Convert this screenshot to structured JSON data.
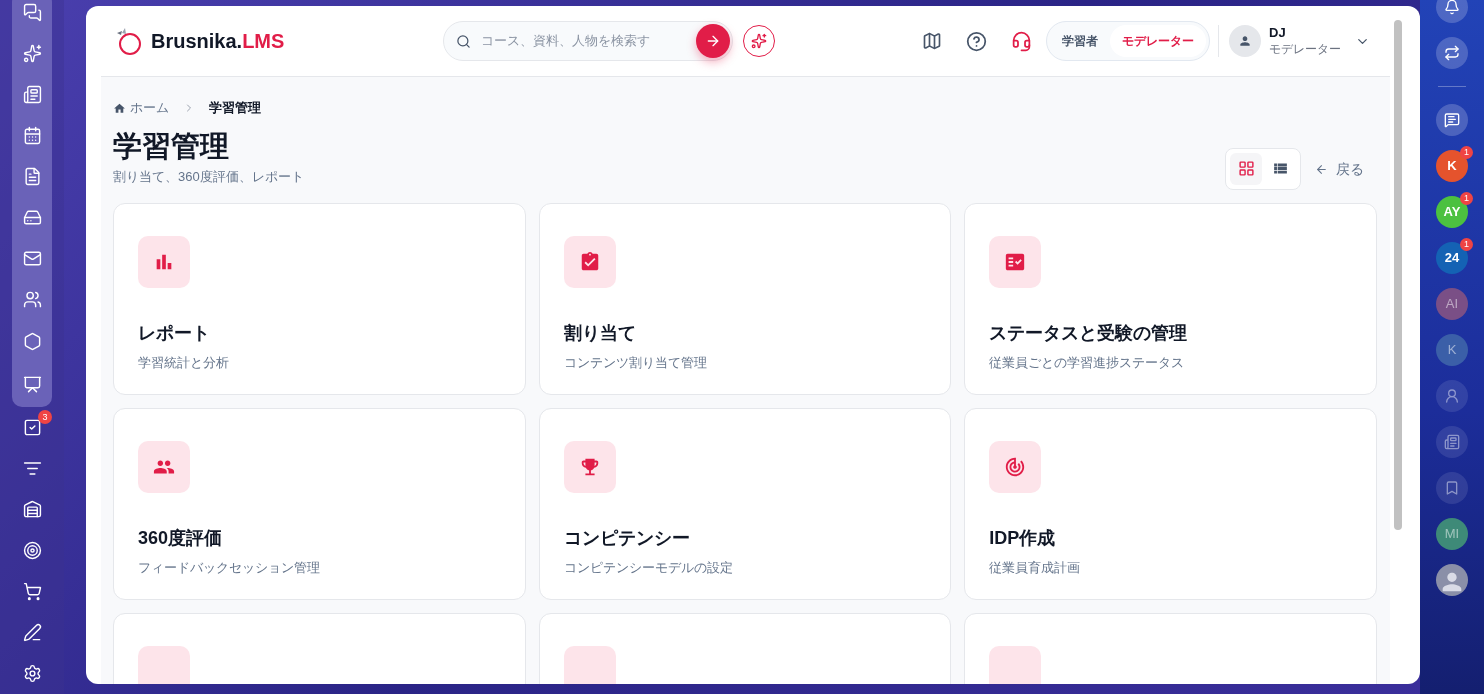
{
  "left_rail": {
    "items": [
      {
        "grouped": true
      },
      {
        "grouped": true
      },
      {
        "grouped": true
      },
      {
        "grouped": true
      },
      {
        "grouped": true
      },
      {
        "grouped": true
      },
      {
        "grouped": true
      },
      {
        "grouped": true
      },
      {
        "grouped": true
      },
      {
        "grouped": true
      },
      {
        "grouped": false,
        "badge": "3"
      },
      {
        "grouped": false
      },
      {
        "grouped": false
      },
      {
        "grouped": false
      },
      {
        "grouped": false
      },
      {
        "grouped": false
      },
      {
        "grouped": false
      }
    ]
  },
  "header": {
    "logo": {
      "brand": "Brusnika.",
      "suffix": "LMS"
    },
    "search": {
      "placeholder": "コース、資料、人物を検索す"
    },
    "roles": [
      {
        "label": "学習者",
        "selected": false
      },
      {
        "label": "モデレーター",
        "selected": true
      }
    ],
    "user": {
      "initials": "DJ",
      "role": "モデレーター"
    }
  },
  "breadcrumb": [
    {
      "label": "ホーム",
      "kind": "home"
    },
    {
      "label": "学習管理",
      "kind": "current"
    }
  ],
  "page": {
    "title": "学習管理",
    "subtitle": "割り当て、360度評価、レポート",
    "back": "戻る",
    "views": [
      {
        "kind": "grid",
        "selected": true
      },
      {
        "kind": "list",
        "selected": false
      }
    ]
  },
  "cards": [
    {
      "kind": "full",
      "title": "レポート",
      "subtitle": "学習統計と分析"
    },
    {
      "kind": "full",
      "title": "割り当て",
      "subtitle": "コンテンツ割り当て管理"
    },
    {
      "kind": "full",
      "title": "ステータスと受験の管理",
      "subtitle": "従業員ごとの学習進捗ステータス"
    },
    {
      "kind": "full",
      "title": "360度評価",
      "subtitle": "フィードバックセッション管理"
    },
    {
      "kind": "full",
      "title": "コンピテンシー",
      "subtitle": "コンピテンシーモデルの設定"
    },
    {
      "kind": "full",
      "title": "IDP作成",
      "subtitle": "従業員育成計画"
    },
    {
      "kind": "partial"
    },
    {
      "kind": "partial"
    },
    {
      "kind": "partial"
    }
  ],
  "right_rail": [
    {
      "kind": "icon",
      "faded": false
    },
    {
      "kind": "icon",
      "faded": false
    },
    {
      "kind": "divider"
    },
    {
      "kind": "icon",
      "faded": false
    },
    {
      "kind": "avatar",
      "label": "K",
      "color": "#e5532d",
      "badge": "1",
      "faded": false
    },
    {
      "kind": "avatar",
      "label": "AY",
      "color": "#4cc140",
      "badge": "1",
      "faded": false
    },
    {
      "kind": "avatar",
      "label": "24",
      "color": "#1462b4",
      "badge": "1",
      "faded": false
    },
    {
      "kind": "avatar",
      "label": "AI",
      "color": "#7a4f86",
      "faded": true
    },
    {
      "kind": "avatar",
      "label": "K",
      "color": "#3b5fa8",
      "faded": true
    },
    {
      "kind": "icon",
      "faded": true
    },
    {
      "kind": "icon",
      "faded": true
    },
    {
      "kind": "icon",
      "faded": true
    },
    {
      "kind": "avatar",
      "label": "MI",
      "color": "#3e8a78",
      "faded": true
    },
    {
      "kind": "photo"
    }
  ]
}
